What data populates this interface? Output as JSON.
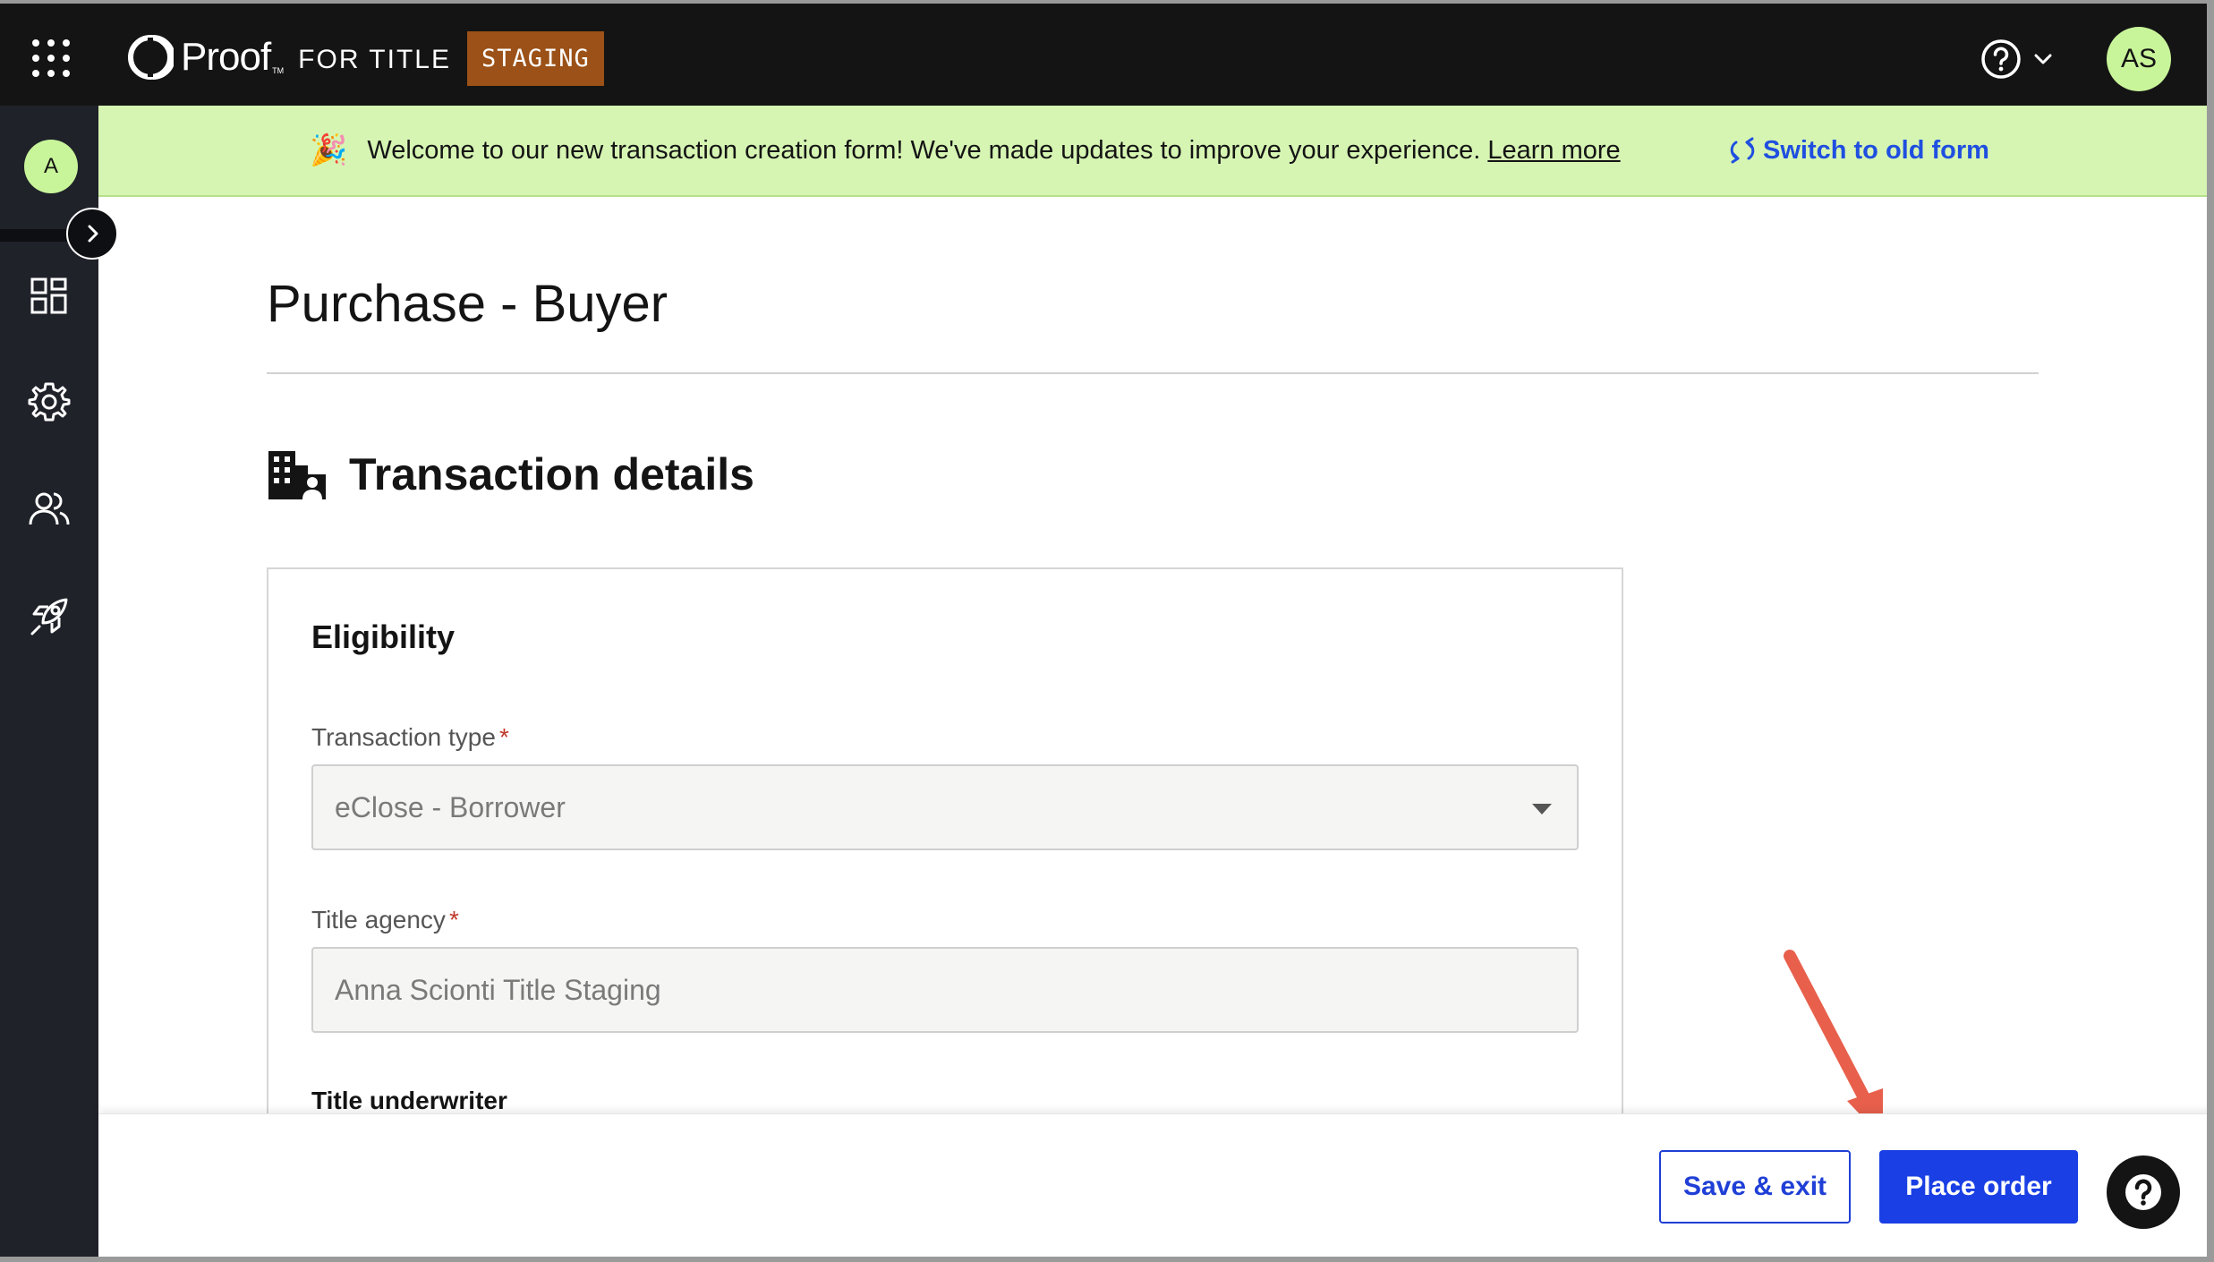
{
  "topbar": {
    "logo_text": "Proof",
    "logo_tm": "TM",
    "logo_sub": "FOR TITLE",
    "env_badge": "STAGING",
    "avatar_initials": "AS"
  },
  "sidebar": {
    "avatar_initial": "A",
    "icons": [
      "dashboard-icon",
      "gear-icon",
      "users-icon",
      "rocket-icon"
    ]
  },
  "banner": {
    "emoji": "🎉",
    "message": "Welcome to our new transaction creation form! We've made updates to improve your experience.",
    "learn_more": "Learn more",
    "switch_label": "Switch to old form"
  },
  "page": {
    "title": "Purchase - Buyer",
    "section_title": "Transaction details"
  },
  "eligibility": {
    "title": "Eligibility",
    "transaction_type_label": "Transaction type",
    "transaction_type_value": "eClose - Borrower",
    "title_agency_label": "Title agency",
    "title_agency_value": "Anna Scionti Title Staging",
    "title_underwriter_label": "Title underwriter",
    "required_mark": "*"
  },
  "footer": {
    "save_label": "Save & exit",
    "place_label": "Place order"
  },
  "colors": {
    "accent": "#1a3fe4",
    "banner_bg": "#d6f5b3",
    "staging_bg": "#9b5117",
    "avatar_bg": "#c9f59a",
    "annotation_arrow": "#e8604c"
  }
}
